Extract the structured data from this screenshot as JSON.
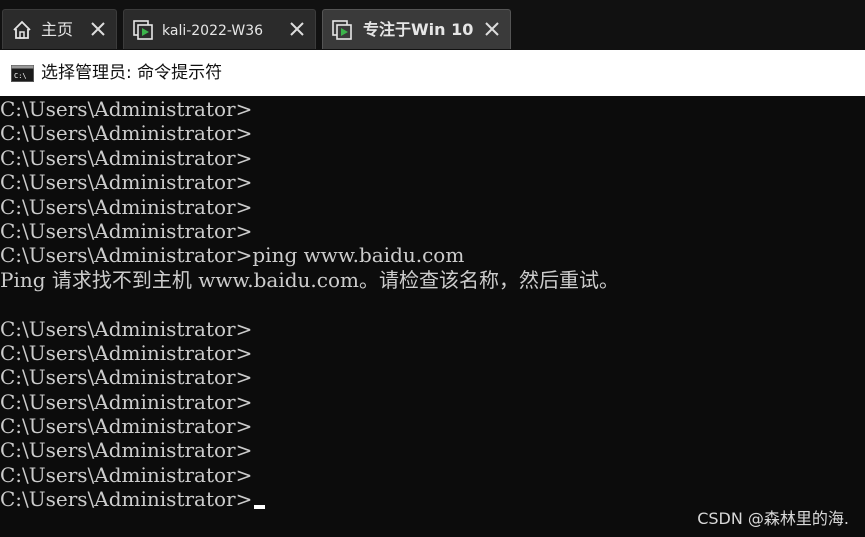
{
  "tabs": [
    {
      "label": "主页",
      "icon": "home-icon",
      "close_icon": "close-icon"
    },
    {
      "label": "kali-2022-W36",
      "icon": "vm-icon",
      "close_icon": "close-icon"
    },
    {
      "label": "专注于Win 10",
      "icon": "vm-icon",
      "close_icon": "close-icon",
      "active": true
    }
  ],
  "window": {
    "title": "选择管理员: 命令提示符",
    "icon": "cmd-icon"
  },
  "console": {
    "lines": [
      "C:\\Users\\Administrator>",
      "C:\\Users\\Administrator>",
      "C:\\Users\\Administrator>",
      "C:\\Users\\Administrator>",
      "C:\\Users\\Administrator>",
      "C:\\Users\\Administrator>",
      "C:\\Users\\Administrator>ping www.baidu.com",
      "Ping 请求找不到主机 www.baidu.com。请检查该名称，然后重试。",
      "",
      "C:\\Users\\Administrator>",
      "C:\\Users\\Administrator>",
      "C:\\Users\\Administrator>",
      "C:\\Users\\Administrator>",
      "C:\\Users\\Administrator>",
      "C:\\Users\\Administrator>",
      "C:\\Users\\Administrator>",
      "C:\\Users\\Administrator>"
    ]
  },
  "watermark": "CSDN @森林里的海.",
  "colors": {
    "console_bg": "#0c0c0c",
    "console_text": "#cccccc",
    "tab_bg": "#2b2b2b",
    "tab_strip_bg": "#111111",
    "vm_icon_green": "#3cb44b"
  }
}
